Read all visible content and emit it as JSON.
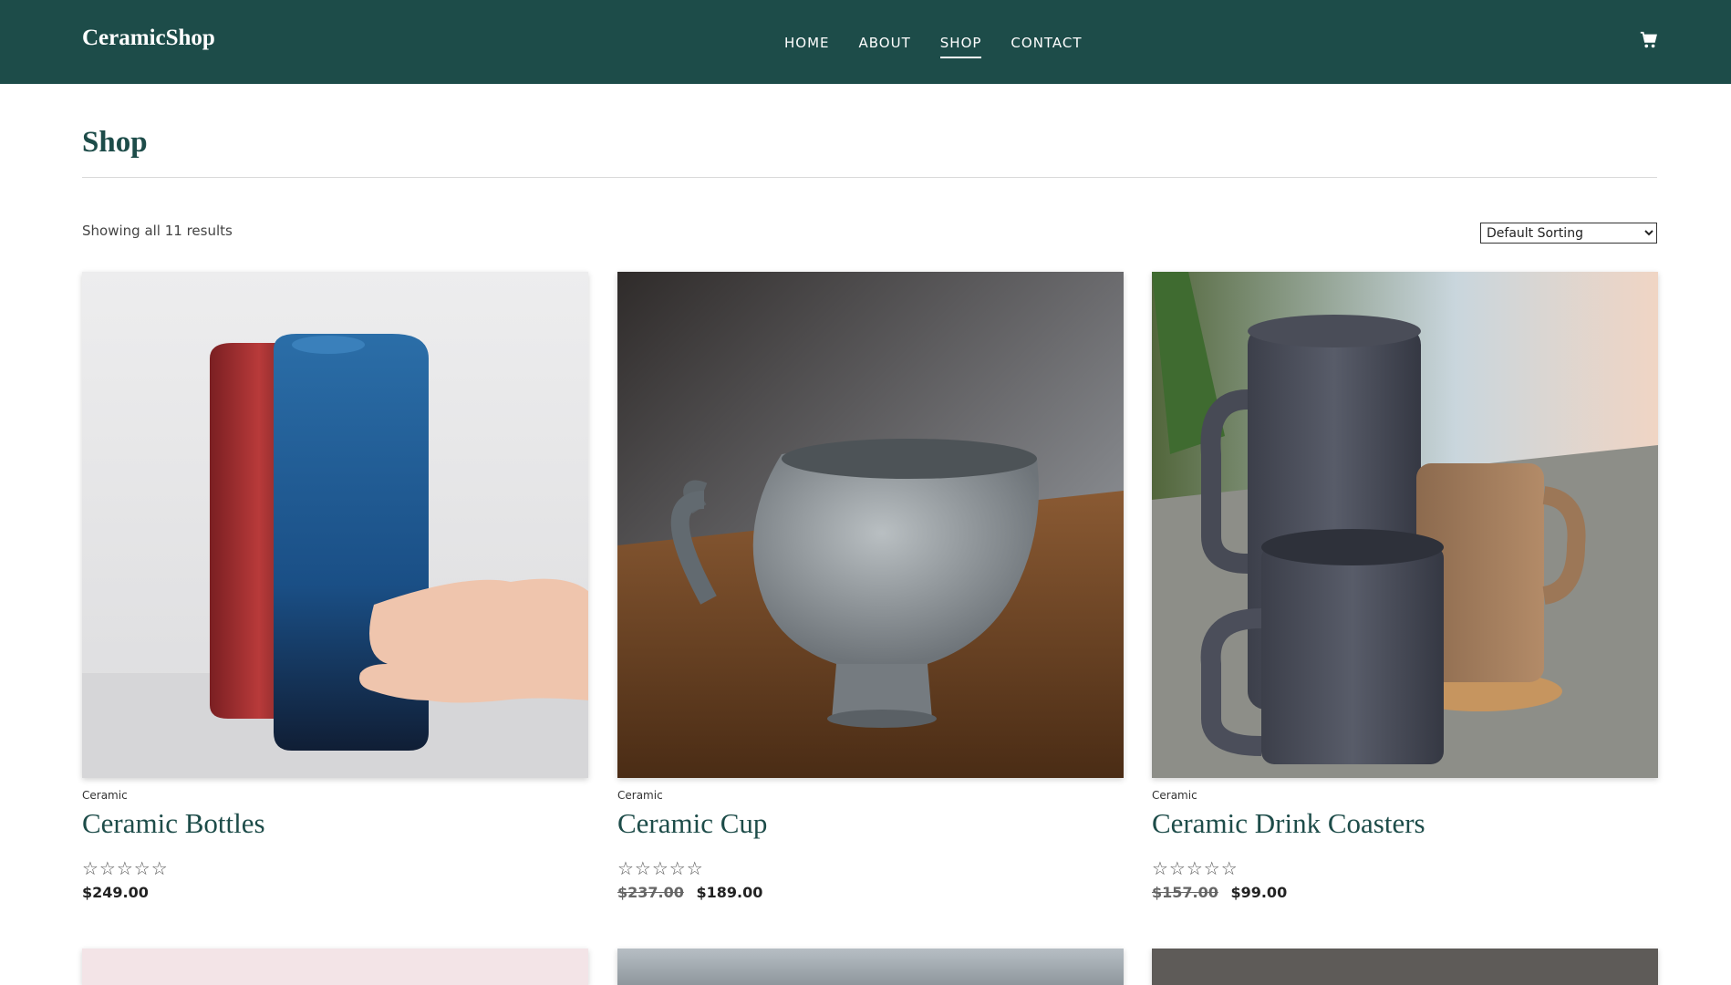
{
  "header": {
    "logo": "CeramicShop",
    "nav": [
      "HOME",
      "ABOUT",
      "SHOP",
      "CONTACT"
    ],
    "active_nav": "SHOP",
    "cart_icon": "cart-icon",
    "bg_color": "#1d4c49"
  },
  "page": {
    "title": "Shop",
    "result_count": "Showing all 11 results",
    "sort_selected": "Default Sorting"
  },
  "products": [
    {
      "category": "Ceramic",
      "name": "Ceramic Bottles",
      "stars": "☆☆☆☆☆",
      "old_price": "",
      "price": "$249.00"
    },
    {
      "category": "Ceramic",
      "name": "Ceramic Cup",
      "stars": "☆☆☆☆☆",
      "old_price": "$237.00",
      "price": "$189.00"
    },
    {
      "category": "Ceramic",
      "name": "Ceramic Drink Coasters",
      "stars": "☆☆☆☆☆",
      "old_price": "$157.00",
      "price": "$99.00"
    }
  ]
}
